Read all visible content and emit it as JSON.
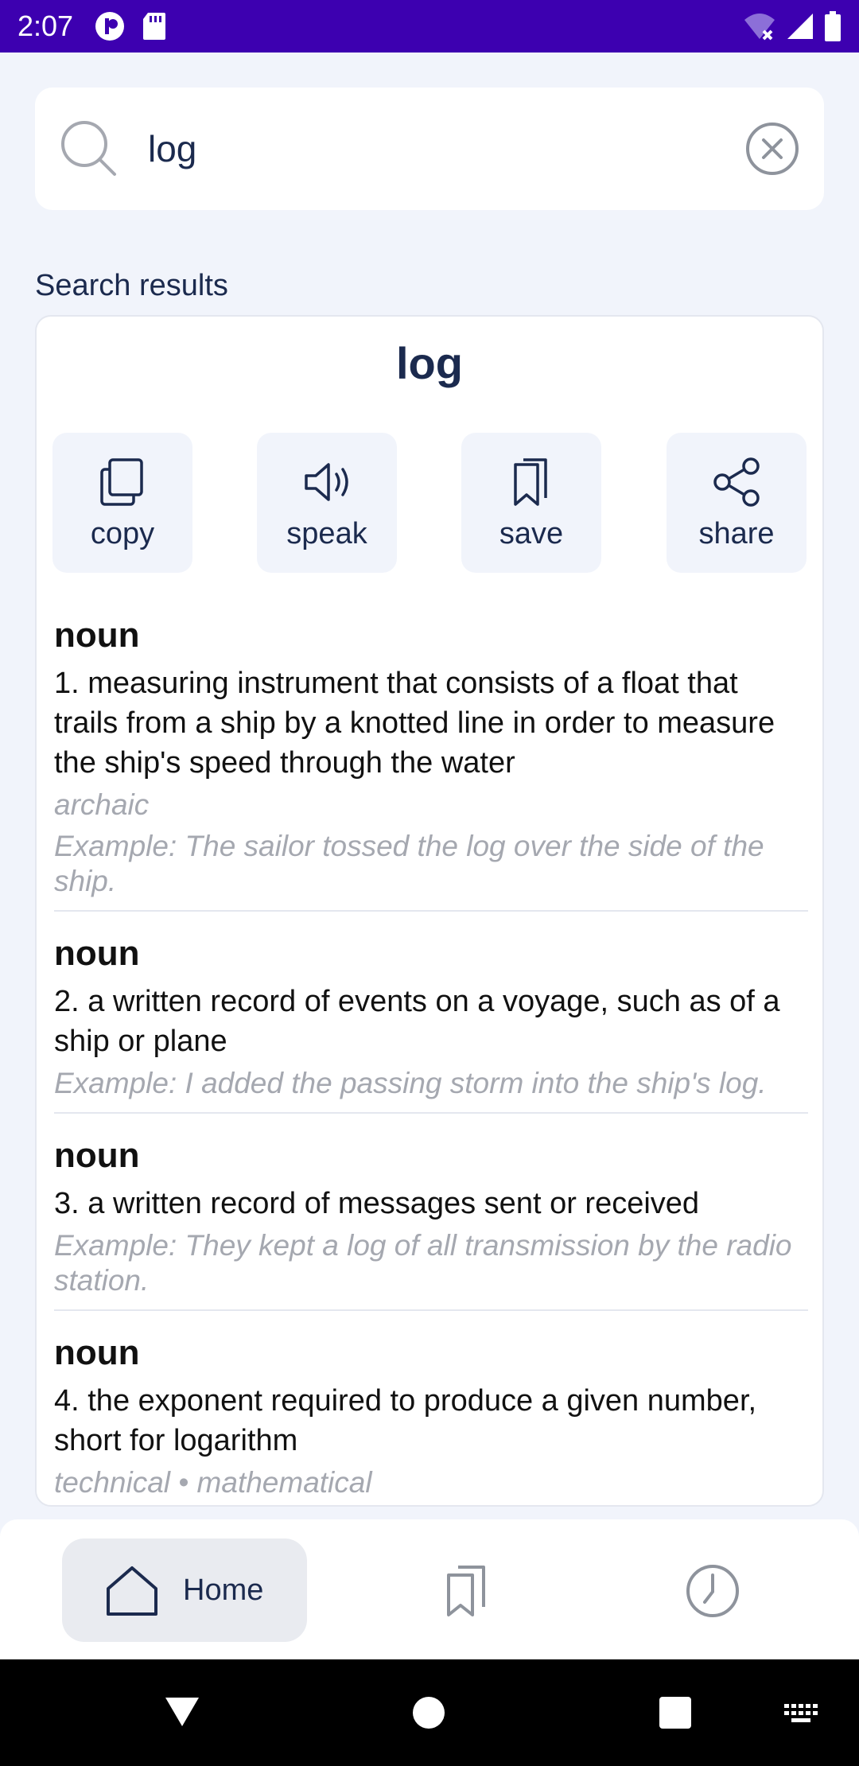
{
  "status_bar": {
    "time": "2:07"
  },
  "search": {
    "query": "log"
  },
  "results_label": "Search results",
  "result": {
    "word": "log",
    "actions": [
      {
        "label": "copy",
        "icon": "copy-icon"
      },
      {
        "label": "speak",
        "icon": "speaker-icon"
      },
      {
        "label": "save",
        "icon": "bookmark-icon"
      },
      {
        "label": "share",
        "icon": "share-icon"
      }
    ],
    "definitions": [
      {
        "pos": "noun",
        "meaning": "1. measuring instrument that consists of a float that trails from a ship by a knotted line in order to measure the ship's speed through the water",
        "usage": "archaic",
        "example": "Example: The sailor tossed the log over the side of the ship."
      },
      {
        "pos": "noun",
        "meaning": "2. a written record of events on a voyage, such as of a ship or plane",
        "usage": "",
        "example": "Example: I added the passing storm into the ship's log."
      },
      {
        "pos": "noun",
        "meaning": "3. a written record of messages sent or received",
        "usage": "",
        "example": "Example: They kept a log of all transmission by the radio station."
      },
      {
        "pos": "noun",
        "meaning": "4. the exponent required to produce a given number, short for logarithm",
        "usage": "technical • mathematical",
        "example": ""
      }
    ]
  },
  "bottom_nav": {
    "home_label": "Home",
    "items": [
      "home-icon",
      "bookmarks-icon",
      "history-icon"
    ]
  },
  "colors": {
    "status_bar": "#3d00b0",
    "background": "#f1f4fb",
    "text": "#1b2a4e",
    "muted": "#a5a8b0"
  }
}
